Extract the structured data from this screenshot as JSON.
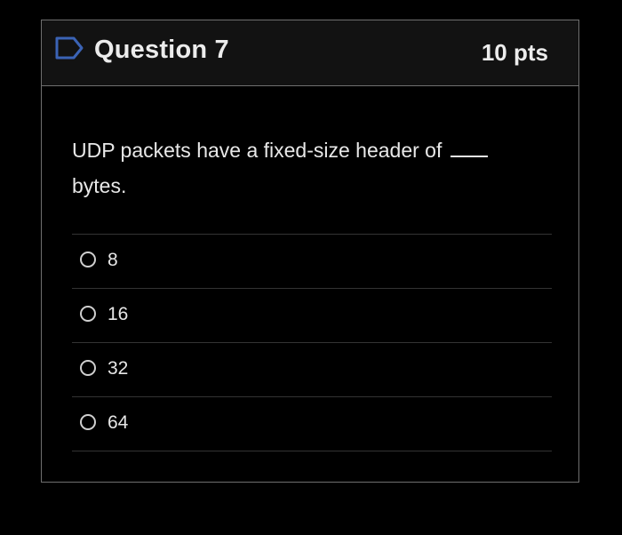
{
  "question": {
    "title": "Question 7",
    "points": "10 pts",
    "text_line1": "UDP packets have a fixed-size header of",
    "text_line2": "bytes."
  },
  "answers": [
    {
      "label": "8"
    },
    {
      "label": "16"
    },
    {
      "label": "32"
    },
    {
      "label": "64"
    }
  ],
  "colors": {
    "background": "#000000",
    "header_background": "#121212",
    "border": "#6f6f6f",
    "text": "#e6e6e6",
    "flag_icon": "#3b63b5"
  },
  "icons": {
    "header_icon": "flag-icon",
    "answer_control": "radio-circle-icon"
  }
}
